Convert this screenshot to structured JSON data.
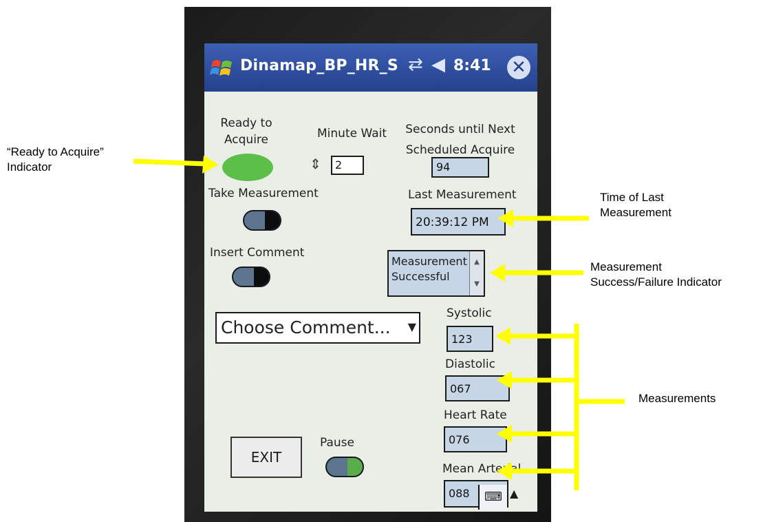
{
  "titlebar": {
    "app_title": "Dinamap_BP_HR_S",
    "time": "8:41",
    "network_icon": "network-icon",
    "volume_icon": "volume-icon",
    "close_icon": "close-icon"
  },
  "ready": {
    "label_line1": "Ready to",
    "label_line2": "Acquire",
    "indicator_color": "#5bbf4a"
  },
  "minute_wait": {
    "label": "Minute Wait",
    "value": "2"
  },
  "next_acquire": {
    "label_line1": "Seconds until Next",
    "label_line2": "Scheduled Acquire",
    "value": "94"
  },
  "take_measurement": {
    "label": "Take Measurement"
  },
  "last_measurement": {
    "label": "Last Measurement",
    "value": "20:39:12 PM"
  },
  "insert_comment": {
    "label": "Insert Comment"
  },
  "status": {
    "line1": "Measurement",
    "line2": "Successful"
  },
  "comment_dropdown": {
    "selected": "Choose Comment..."
  },
  "systolic": {
    "label": "Systolic",
    "value": "123"
  },
  "diastolic": {
    "label": "Diastolic",
    "value": "067"
  },
  "heart_rate": {
    "label": "Heart Rate",
    "value": "076"
  },
  "mean_arterial": {
    "label": "Mean Arterial",
    "value": "088"
  },
  "pause": {
    "label": "Pause"
  },
  "exit_button": {
    "label": "EXIT"
  },
  "annotations": {
    "ready_line1": "“Ready to Acquire”",
    "ready_line2": "Indicator",
    "time_line1": "Time of Last",
    "time_line2": "Measurement",
    "success_line1": "Measurement",
    "success_line2": "Success/Failure Indicator",
    "measurements": "Measurements",
    "arrow_color": "#ffff00"
  }
}
